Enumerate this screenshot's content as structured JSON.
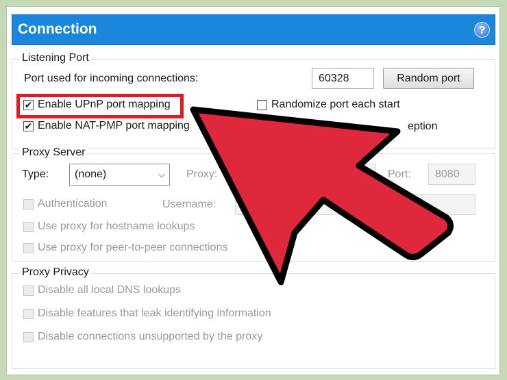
{
  "title": "Connection",
  "help_icon": "?",
  "listening_port": {
    "group_label": "Listening Port",
    "port_label": "Port used for incoming connections:",
    "port_value": "60328",
    "random_port_label": "Random port",
    "upnp_label": "Enable UPnP port mapping",
    "upnp_checked": true,
    "natpmp_label": "Enable NAT-PMP port mapping",
    "natpmp_checked": true,
    "randomize_label": "Randomize port each start",
    "randomize_checked": false,
    "exception_fragment": "eption"
  },
  "proxy_server": {
    "group_label": "Proxy Server",
    "type_label": "Type:",
    "type_value": "(none)",
    "proxy_label": "Proxy:",
    "port_label": "Port:",
    "port_value": "8080",
    "auth_label": "Authentication",
    "username_label": "Username:",
    "hostname_label": "Use proxy for hostname lookups",
    "p2p_label": "Use proxy for peer-to-peer connections"
  },
  "proxy_privacy": {
    "group_label": "Proxy Privacy",
    "dns_label": "Disable all local DNS lookups",
    "leak_label": "Disable features that leak identifying information",
    "unsupported_label": "Disable connections unsupported by the proxy"
  },
  "colors": {
    "titlebar": "#1a87dd",
    "highlight": "#e01b24",
    "arrow_fill": "#e0283c",
    "background": "#c6d9b6"
  },
  "icons": {
    "help": "help-icon",
    "dropdown": "chevron-down-icon",
    "check": "checkmark-icon",
    "pointer": "arrow-pointer-icon"
  }
}
